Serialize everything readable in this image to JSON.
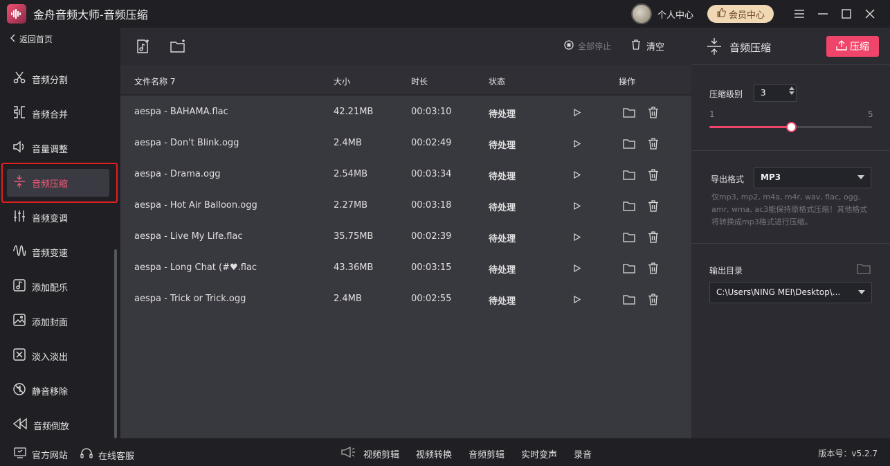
{
  "app": {
    "title": "金舟音频大师-音频压缩",
    "user_center": "个人中心",
    "vip_label": "会员中心"
  },
  "sidebar": {
    "back_label": "返回首页",
    "items": [
      {
        "label": "音频分割",
        "icon": "scissors-icon"
      },
      {
        "label": "音频合并",
        "icon": "merge-icon"
      },
      {
        "label": "音量调整",
        "icon": "volume-icon"
      },
      {
        "label": "音频压缩",
        "icon": "compress-icon",
        "active": true
      },
      {
        "label": "音频变调",
        "icon": "equalizer-icon"
      },
      {
        "label": "音频变速",
        "icon": "wave-icon"
      },
      {
        "label": "添加配乐",
        "icon": "music-note-icon"
      },
      {
        "label": "添加封面",
        "icon": "image-icon"
      },
      {
        "label": "淡入淡出",
        "icon": "fade-icon"
      },
      {
        "label": "静音移除",
        "icon": "mute-icon"
      },
      {
        "label": "音频倒放",
        "icon": "rewind-icon"
      }
    ]
  },
  "toolbar": {
    "stop_all": "全部停止",
    "clear": "清空"
  },
  "table": {
    "headers": {
      "name": "文件名称 7",
      "size": "大小",
      "duration": "时长",
      "status": "状态",
      "actions": "操作"
    },
    "rows": [
      {
        "name": "aespa - BAHAMA.flac",
        "size": "42.21MB",
        "duration": "00:03:10",
        "status": "待处理"
      },
      {
        "name": "aespa - Don't Blink.ogg",
        "size": "2.4MB",
        "duration": "00:02:49",
        "status": "待处理"
      },
      {
        "name": "aespa - Drama.ogg",
        "size": "2.54MB",
        "duration": "00:03:34",
        "status": "待处理"
      },
      {
        "name": "aespa - Hot Air Balloon.ogg",
        "size": "2.27MB",
        "duration": "00:03:18",
        "status": "待处理"
      },
      {
        "name": "aespa - Live My Life.flac",
        "size": "35.75MB",
        "duration": "00:02:39",
        "status": "待处理"
      },
      {
        "name": "aespa - Long Chat (#♥.flac",
        "size": "43.36MB",
        "duration": "00:03:15",
        "status": "待处理"
      },
      {
        "name": "aespa - Trick or Trick.ogg",
        "size": "2.4MB",
        "duration": "00:02:55",
        "status": "待处理"
      }
    ]
  },
  "panel": {
    "title": "音频压缩",
    "compress_button": "压缩",
    "level_label": "压缩级别",
    "level_value": "3",
    "slider_min": "1",
    "slider_max": "5",
    "slider_fraction": 0.5,
    "format_label": "导出格式",
    "format_value": "MP3",
    "format_note": "仅mp3, mp2, m4a, m4r, wav, flac, ogg, amr, wma, ac3能保持原格式压缩！其他格式将转换成mp3格式进行压缩。",
    "output_label": "输出目录",
    "output_value": "C:\\Users\\NING MEI\\Desktop\\..."
  },
  "footer": {
    "website": "官方网站",
    "service": "在线客服",
    "links": [
      "视频剪辑",
      "视频转换",
      "音频剪辑",
      "实时变声",
      "录音"
    ],
    "version": "版本号：v5.2.7"
  },
  "colors": {
    "accent": "#f0456a",
    "active_outline": "#e02020",
    "vip_bg": "#f1d8b5"
  }
}
